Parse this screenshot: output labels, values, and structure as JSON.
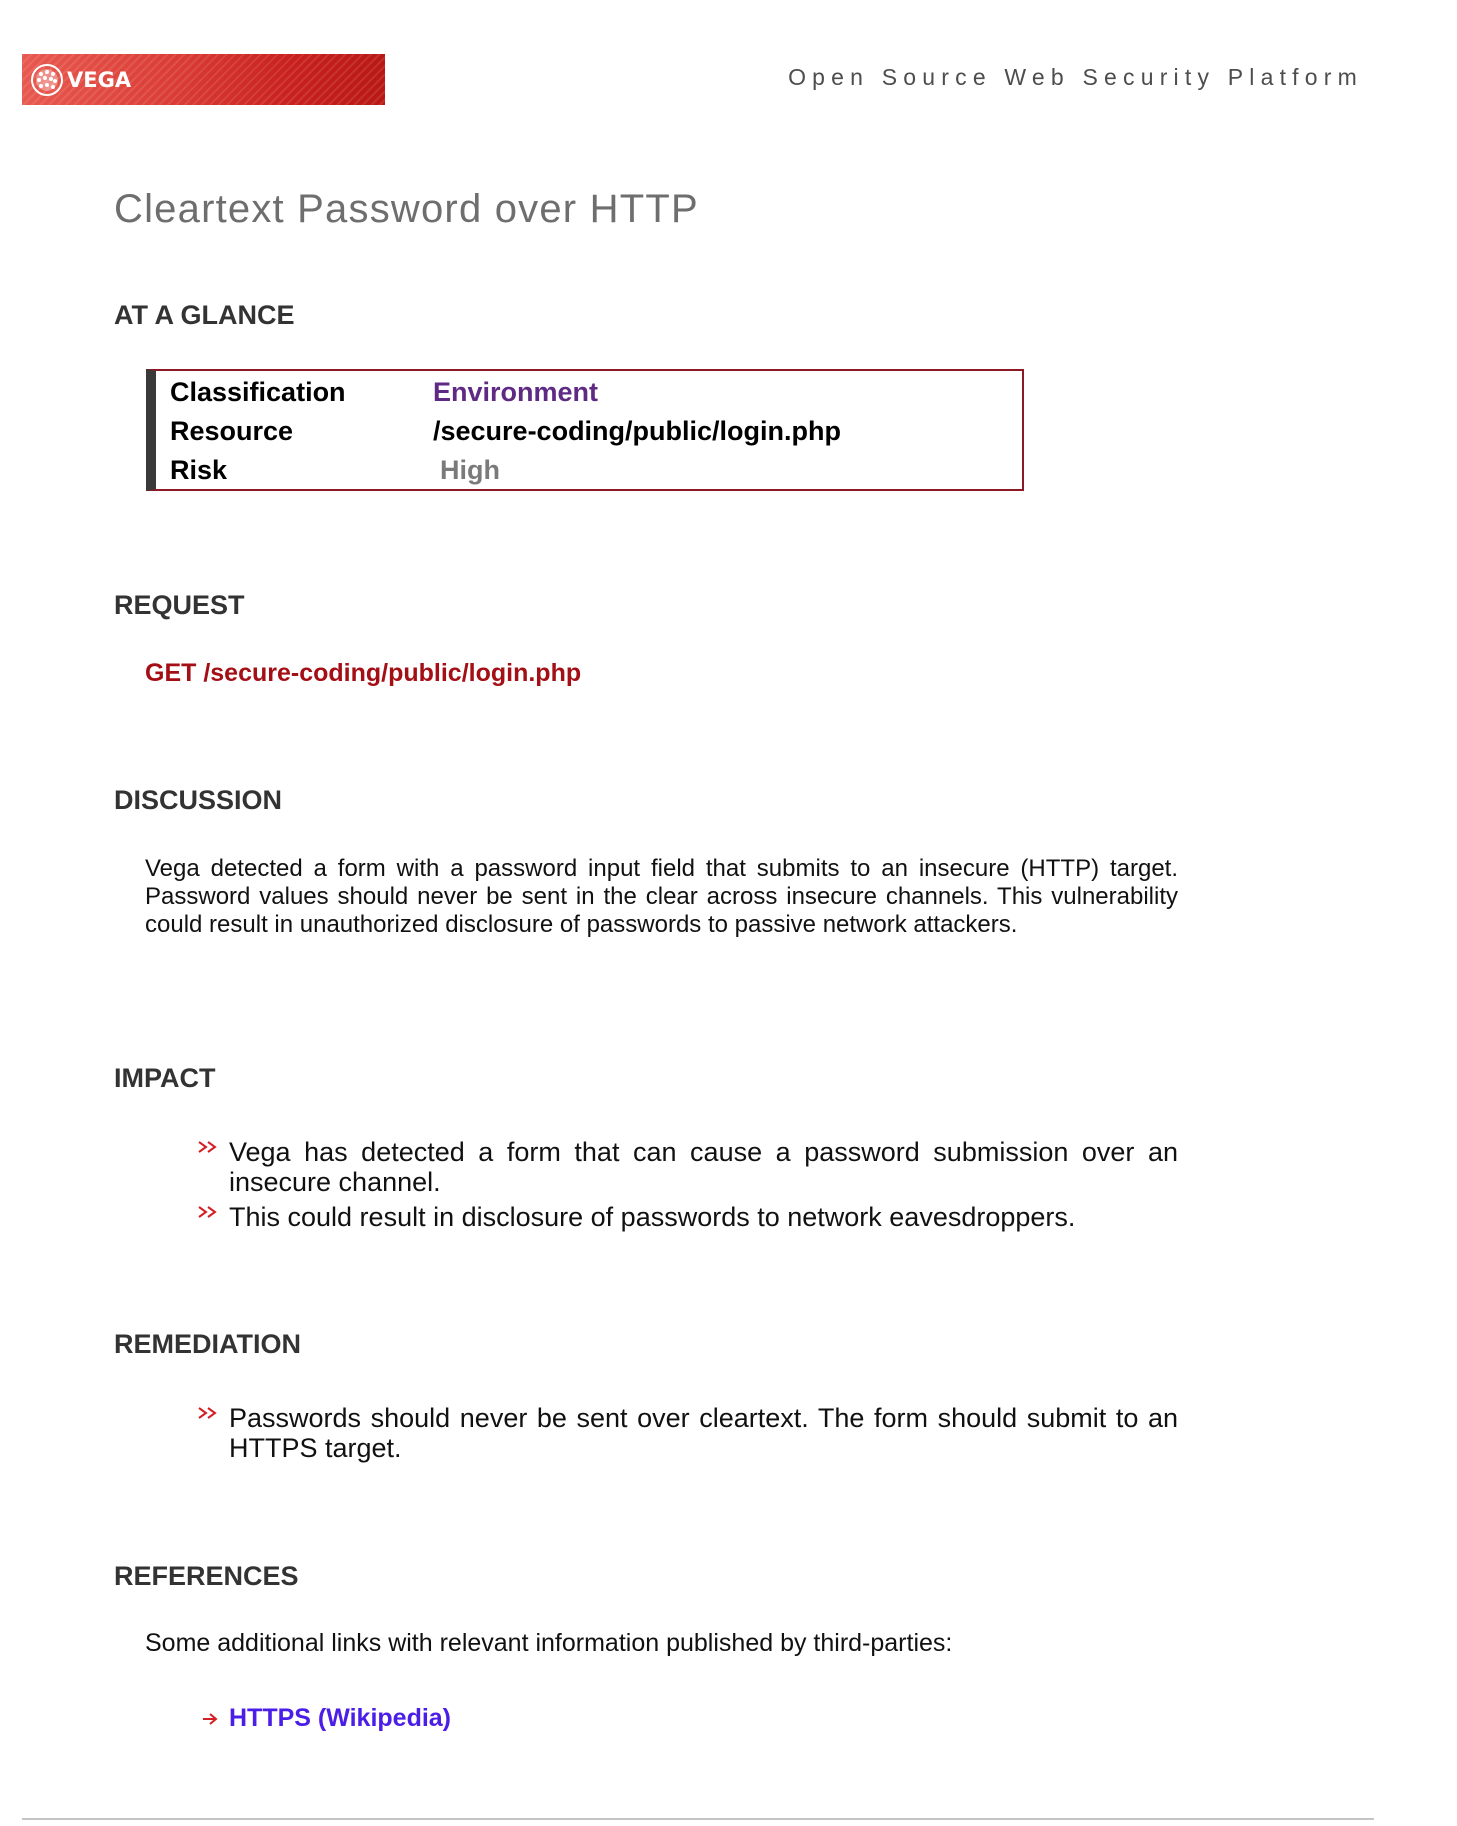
{
  "header": {
    "logo_text": "VEGA",
    "tagline": "Open Source Web Security Platform"
  },
  "title": "Cleartext Password over HTTP",
  "at_a_glance": {
    "heading": "AT A GLANCE",
    "rows": [
      {
        "label": "Classification",
        "value": "Environment"
      },
      {
        "label": "Resource",
        "value": "/secure-coding/public/login.php"
      },
      {
        "label": "Risk",
        "value": "High"
      }
    ]
  },
  "request": {
    "heading": "REQUEST",
    "line": "GET /secure-coding/public/login.php"
  },
  "discussion": {
    "heading": "DISCUSSION",
    "text": "Vega detected a form with a password input field that submits to an insecure (HTTP) target. Password values should never be sent in the clear across insecure channels. This vulnerability could result in unauthorized disclosure of passwords to passive network attackers."
  },
  "impact": {
    "heading": "IMPACT",
    "items": [
      "Vega has detected a form that can cause a password submission over an insecure channel.",
      "This could result in disclosure of passwords to network eavesdroppers."
    ]
  },
  "remediation": {
    "heading": "REMEDIATION",
    "items": [
      "Passwords should never be sent over cleartext. The form should submit to an HTTPS target."
    ]
  },
  "references": {
    "heading": "REFERENCES",
    "intro": "Some additional links with relevant information published by third-parties:",
    "links": [
      {
        "label": "HTTPS (Wikipedia)"
      }
    ]
  },
  "colors": {
    "brand_red": "#c8201d",
    "classification_purple": "#5e2a84",
    "request_red": "#a30f15",
    "link_blue": "#4b1ee8",
    "risk_gray": "#7a7a7a"
  },
  "icons": [
    "vega-logo-icon",
    "double-chevron-icon",
    "arrow-right-icon"
  ]
}
